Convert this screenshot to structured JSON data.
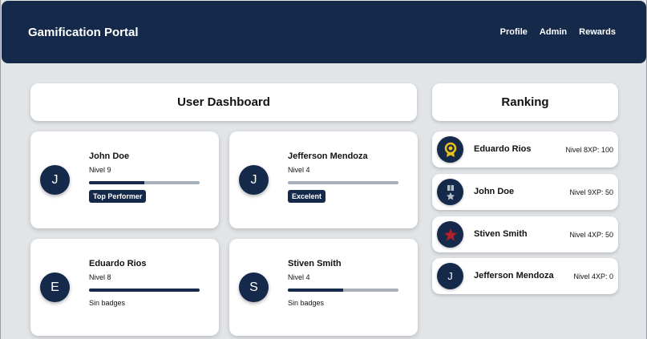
{
  "header": {
    "brand": "Gamification Portal",
    "nav": [
      "Profile",
      "Admin",
      "Rewards"
    ]
  },
  "dashboard": {
    "title": "User Dashboard",
    "users": [
      {
        "initial": "J",
        "name": "John Doe",
        "level": "Nivel 9",
        "progress": 0.5,
        "badge": "Top Performer"
      },
      {
        "initial": "J",
        "name": "Jefferson Mendoza",
        "level": "Nivel 4",
        "progress": 0.0,
        "badge": "Excelent"
      },
      {
        "initial": "E",
        "name": "Eduardo Rios",
        "level": "Nivel 8",
        "progress": 1.0,
        "badge": "Sin badges"
      },
      {
        "initial": "S",
        "name": "Stiven Smith",
        "level": "Nivel 4",
        "progress": 0.5,
        "badge": "Sin badges"
      }
    ]
  },
  "ranking": {
    "title": "Ranking",
    "items": [
      {
        "icon": "gold-medal-icon",
        "name": "Eduardo Rios",
        "meta": "Nivel 8XP: 100"
      },
      {
        "icon": "silver-medal-icon",
        "name": "John Doe",
        "meta": "Nivel 9XP: 50"
      },
      {
        "icon": "red-star-icon",
        "name": "Stiven Smith",
        "meta": "Nivel 4XP: 50"
      },
      {
        "initial": "J",
        "name": "Jefferson Mendoza",
        "meta": "Nivel 4XP: 0"
      }
    ]
  },
  "colors": {
    "primary": "#15294a",
    "background": "#e2e5e8",
    "bar_track": "#a7b0b8",
    "gold": "#e8c21b",
    "silver": "#b8bec6",
    "star_red": "#b3202a"
  }
}
